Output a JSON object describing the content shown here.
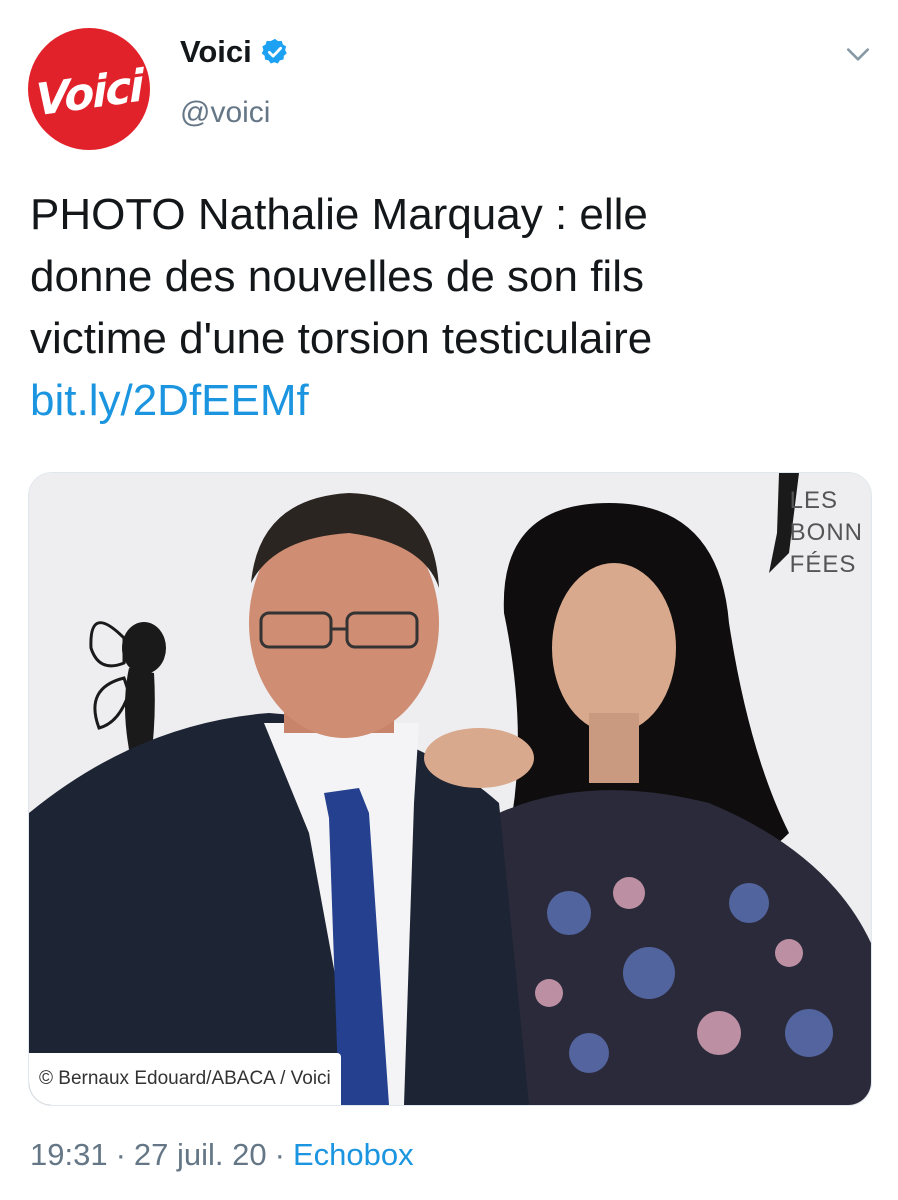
{
  "account": {
    "avatar_text": "Voici",
    "display_name": "Voici",
    "handle": "@voici",
    "verified": true
  },
  "tweet": {
    "lines": [
      "PHOTO Nathalie Marquay : elle",
      "donne des nouvelles de son fils",
      "victime d'une torsion testiculaire"
    ],
    "link": "bit.ly/2DfEEMf"
  },
  "media": {
    "credit": "© Bernaux Edouard/ABACA / Voici",
    "backdrop_lines": [
      "LES",
      "BONN",
      "FÉES"
    ]
  },
  "meta": {
    "time": "19:31",
    "separator": "·",
    "date": "27 juil. 20",
    "source": "Echobox"
  },
  "colors": {
    "brand_red": "#e2222a",
    "link_blue": "#1b95e0",
    "muted_gray": "#657786"
  },
  "icons": {
    "verified": "verified-badge-icon",
    "chevron": "chevron-down-icon"
  }
}
